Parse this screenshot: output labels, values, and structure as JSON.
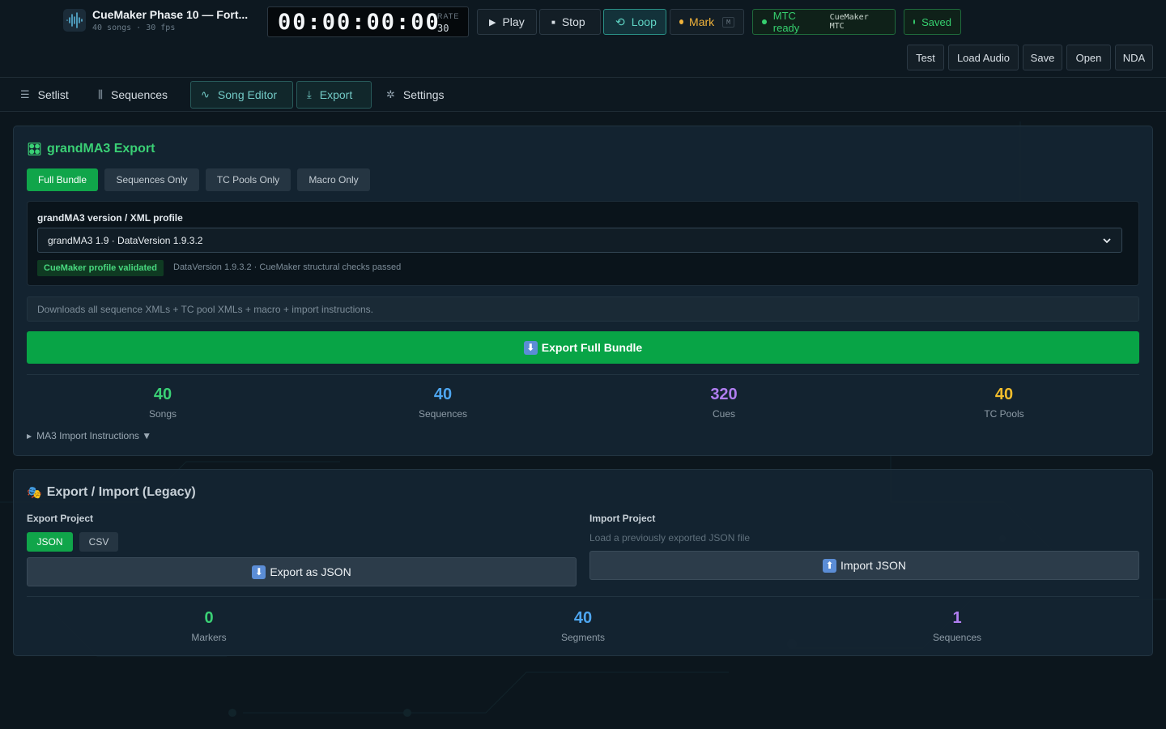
{
  "header": {
    "app_title": "CueMaker Phase 10 — Fort...",
    "app_subtitle": "40 songs · 30 fps",
    "timecode": "00:00:00:00",
    "rate_label": "RATE",
    "rate_value": "30",
    "play_label": "Play",
    "stop_label": "Stop",
    "loop_label": "Loop",
    "mark_label": "Mark",
    "mark_shortcut": "M",
    "mtc_status": "MTC ready",
    "mtc_device": "CueMaker MTC",
    "saved_status": "Saved",
    "secondary_buttons": [
      "Test",
      "Load Audio",
      "Save",
      "Open",
      "NDA"
    ]
  },
  "nav": {
    "tabs": [
      {
        "label": "Setlist",
        "icon": "list-icon"
      },
      {
        "label": "Sequences",
        "icon": "columns-icon"
      },
      {
        "label": "Song Editor",
        "icon": "waveform-icon"
      },
      {
        "label": "Export",
        "icon": "download-icon"
      },
      {
        "label": "Settings",
        "icon": "gear-icon"
      }
    ],
    "active_tabs": [
      "Song Editor",
      "Export"
    ]
  },
  "ma3_export": {
    "title": "grandMA3 Export",
    "modes": [
      "Full Bundle",
      "Sequences Only",
      "TC Pools Only",
      "Macro Only"
    ],
    "active_mode": "Full Bundle",
    "version_label": "grandMA3 version / XML profile",
    "version_selected": "grandMA3 1.9 · DataVersion 1.9.3.2",
    "validated_badge": "CueMaker profile validated",
    "validated_text": "DataVersion 1.9.3.2 · CueMaker structural checks passed",
    "description": "Downloads all sequence XMLs + TC pool XMLs + macro + import instructions.",
    "export_button": "Export Full Bundle",
    "stats": [
      {
        "value": "40",
        "label": "Songs",
        "color": "#3ad075"
      },
      {
        "value": "40",
        "label": "Sequences",
        "color": "#4ea6f0"
      },
      {
        "value": "320",
        "label": "Cues",
        "color": "#b07ef0"
      },
      {
        "value": "40",
        "label": "TC Pools",
        "color": "#f2bd2c"
      }
    ],
    "instructions_toggle": "MA3 Import Instructions ▼"
  },
  "legacy": {
    "title": "Export / Import (Legacy)",
    "export_label": "Export Project",
    "formats": [
      "JSON",
      "CSV"
    ],
    "active_format": "JSON",
    "export_button": "Export as JSON",
    "import_label": "Import Project",
    "import_hint": "Load a previously exported JSON file",
    "import_button": "Import JSON",
    "stats": [
      {
        "value": "0",
        "label": "Markers",
        "color": "#3ad075"
      },
      {
        "value": "40",
        "label": "Segments",
        "color": "#4ea6f0"
      },
      {
        "value": "1",
        "label": "Sequences",
        "color": "#b07ef0"
      }
    ]
  },
  "colors": {
    "accent_green": "#08a446",
    "accent_teal": "#5fd3c3",
    "mark_orange": "#f0b33b"
  }
}
